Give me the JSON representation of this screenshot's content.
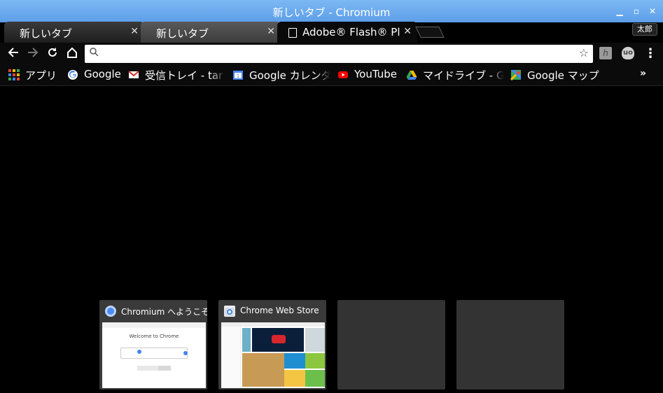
{
  "window": {
    "title": "新しいタブ - Chromium"
  },
  "tabs": [
    {
      "label": "新しいタブ"
    },
    {
      "label": "新しいタブ"
    },
    {
      "label": "Adobe® Flash® Pl"
    }
  ],
  "profile": {
    "name": "太郎"
  },
  "omnibox": {
    "value": "",
    "placeholder": ""
  },
  "bookmarks": [
    {
      "label": "アプリ"
    },
    {
      "label": "Google"
    },
    {
      "label": "受信トレイ - tar"
    },
    {
      "label": "Google カレンダ"
    },
    {
      "label": "YouTube"
    },
    {
      "label": "マイドライブ - G"
    },
    {
      "label": "Google マップ"
    }
  ],
  "most_visited": [
    {
      "title": "Chromium へようこそ",
      "thumb_heading": "Welcome to Chrome"
    },
    {
      "title": "Chrome Web Store"
    }
  ],
  "colors": {
    "titlebar": "#6aa9ee",
    "background": "#000000",
    "gmail_red": "#d93025",
    "youtube_red": "#ff0000"
  }
}
